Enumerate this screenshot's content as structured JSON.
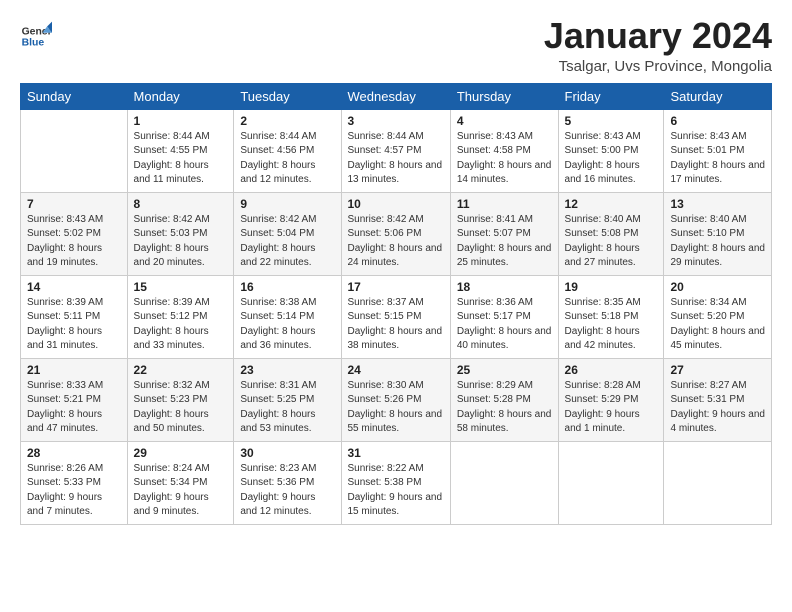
{
  "logo": {
    "line1": "General",
    "line2": "Blue"
  },
  "title": "January 2024",
  "location": "Tsalgar, Uvs Province, Mongolia",
  "weekdays": [
    "Sunday",
    "Monday",
    "Tuesday",
    "Wednesday",
    "Thursday",
    "Friday",
    "Saturday"
  ],
  "weeks": [
    [
      {
        "day": "",
        "sunrise": "",
        "sunset": "",
        "daylight": ""
      },
      {
        "day": "1",
        "sunrise": "Sunrise: 8:44 AM",
        "sunset": "Sunset: 4:55 PM",
        "daylight": "Daylight: 8 hours and 11 minutes."
      },
      {
        "day": "2",
        "sunrise": "Sunrise: 8:44 AM",
        "sunset": "Sunset: 4:56 PM",
        "daylight": "Daylight: 8 hours and 12 minutes."
      },
      {
        "day": "3",
        "sunrise": "Sunrise: 8:44 AM",
        "sunset": "Sunset: 4:57 PM",
        "daylight": "Daylight: 8 hours and 13 minutes."
      },
      {
        "day": "4",
        "sunrise": "Sunrise: 8:43 AM",
        "sunset": "Sunset: 4:58 PM",
        "daylight": "Daylight: 8 hours and 14 minutes."
      },
      {
        "day": "5",
        "sunrise": "Sunrise: 8:43 AM",
        "sunset": "Sunset: 5:00 PM",
        "daylight": "Daylight: 8 hours and 16 minutes."
      },
      {
        "day": "6",
        "sunrise": "Sunrise: 8:43 AM",
        "sunset": "Sunset: 5:01 PM",
        "daylight": "Daylight: 8 hours and 17 minutes."
      }
    ],
    [
      {
        "day": "7",
        "sunrise": "Sunrise: 8:43 AM",
        "sunset": "Sunset: 5:02 PM",
        "daylight": "Daylight: 8 hours and 19 minutes."
      },
      {
        "day": "8",
        "sunrise": "Sunrise: 8:42 AM",
        "sunset": "Sunset: 5:03 PM",
        "daylight": "Daylight: 8 hours and 20 minutes."
      },
      {
        "day": "9",
        "sunrise": "Sunrise: 8:42 AM",
        "sunset": "Sunset: 5:04 PM",
        "daylight": "Daylight: 8 hours and 22 minutes."
      },
      {
        "day": "10",
        "sunrise": "Sunrise: 8:42 AM",
        "sunset": "Sunset: 5:06 PM",
        "daylight": "Daylight: 8 hours and 24 minutes."
      },
      {
        "day": "11",
        "sunrise": "Sunrise: 8:41 AM",
        "sunset": "Sunset: 5:07 PM",
        "daylight": "Daylight: 8 hours and 25 minutes."
      },
      {
        "day": "12",
        "sunrise": "Sunrise: 8:40 AM",
        "sunset": "Sunset: 5:08 PM",
        "daylight": "Daylight: 8 hours and 27 minutes."
      },
      {
        "day": "13",
        "sunrise": "Sunrise: 8:40 AM",
        "sunset": "Sunset: 5:10 PM",
        "daylight": "Daylight: 8 hours and 29 minutes."
      }
    ],
    [
      {
        "day": "14",
        "sunrise": "Sunrise: 8:39 AM",
        "sunset": "Sunset: 5:11 PM",
        "daylight": "Daylight: 8 hours and 31 minutes."
      },
      {
        "day": "15",
        "sunrise": "Sunrise: 8:39 AM",
        "sunset": "Sunset: 5:12 PM",
        "daylight": "Daylight: 8 hours and 33 minutes."
      },
      {
        "day": "16",
        "sunrise": "Sunrise: 8:38 AM",
        "sunset": "Sunset: 5:14 PM",
        "daylight": "Daylight: 8 hours and 36 minutes."
      },
      {
        "day": "17",
        "sunrise": "Sunrise: 8:37 AM",
        "sunset": "Sunset: 5:15 PM",
        "daylight": "Daylight: 8 hours and 38 minutes."
      },
      {
        "day": "18",
        "sunrise": "Sunrise: 8:36 AM",
        "sunset": "Sunset: 5:17 PM",
        "daylight": "Daylight: 8 hours and 40 minutes."
      },
      {
        "day": "19",
        "sunrise": "Sunrise: 8:35 AM",
        "sunset": "Sunset: 5:18 PM",
        "daylight": "Daylight: 8 hours and 42 minutes."
      },
      {
        "day": "20",
        "sunrise": "Sunrise: 8:34 AM",
        "sunset": "Sunset: 5:20 PM",
        "daylight": "Daylight: 8 hours and 45 minutes."
      }
    ],
    [
      {
        "day": "21",
        "sunrise": "Sunrise: 8:33 AM",
        "sunset": "Sunset: 5:21 PM",
        "daylight": "Daylight: 8 hours and 47 minutes."
      },
      {
        "day": "22",
        "sunrise": "Sunrise: 8:32 AM",
        "sunset": "Sunset: 5:23 PM",
        "daylight": "Daylight: 8 hours and 50 minutes."
      },
      {
        "day": "23",
        "sunrise": "Sunrise: 8:31 AM",
        "sunset": "Sunset: 5:25 PM",
        "daylight": "Daylight: 8 hours and 53 minutes."
      },
      {
        "day": "24",
        "sunrise": "Sunrise: 8:30 AM",
        "sunset": "Sunset: 5:26 PM",
        "daylight": "Daylight: 8 hours and 55 minutes."
      },
      {
        "day": "25",
        "sunrise": "Sunrise: 8:29 AM",
        "sunset": "Sunset: 5:28 PM",
        "daylight": "Daylight: 8 hours and 58 minutes."
      },
      {
        "day": "26",
        "sunrise": "Sunrise: 8:28 AM",
        "sunset": "Sunset: 5:29 PM",
        "daylight": "Daylight: 9 hours and 1 minute."
      },
      {
        "day": "27",
        "sunrise": "Sunrise: 8:27 AM",
        "sunset": "Sunset: 5:31 PM",
        "daylight": "Daylight: 9 hours and 4 minutes."
      }
    ],
    [
      {
        "day": "28",
        "sunrise": "Sunrise: 8:26 AM",
        "sunset": "Sunset: 5:33 PM",
        "daylight": "Daylight: 9 hours and 7 minutes."
      },
      {
        "day": "29",
        "sunrise": "Sunrise: 8:24 AM",
        "sunset": "Sunset: 5:34 PM",
        "daylight": "Daylight: 9 hours and 9 minutes."
      },
      {
        "day": "30",
        "sunrise": "Sunrise: 8:23 AM",
        "sunset": "Sunset: 5:36 PM",
        "daylight": "Daylight: 9 hours and 12 minutes."
      },
      {
        "day": "31",
        "sunrise": "Sunrise: 8:22 AM",
        "sunset": "Sunset: 5:38 PM",
        "daylight": "Daylight: 9 hours and 15 minutes."
      },
      {
        "day": "",
        "sunrise": "",
        "sunset": "",
        "daylight": ""
      },
      {
        "day": "",
        "sunrise": "",
        "sunset": "",
        "daylight": ""
      },
      {
        "day": "",
        "sunrise": "",
        "sunset": "",
        "daylight": ""
      }
    ]
  ]
}
